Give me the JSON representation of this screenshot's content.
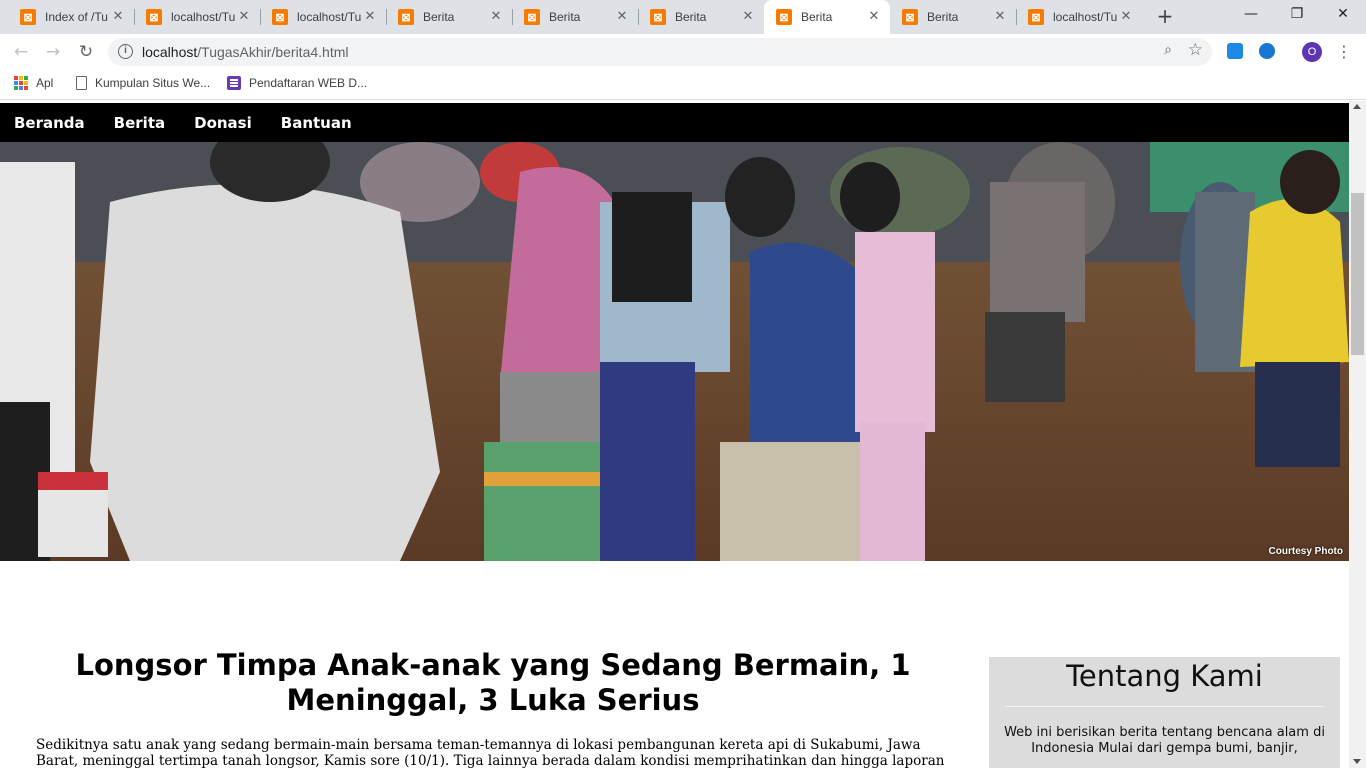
{
  "browser": {
    "tabs": [
      {
        "title": "Index of /Tu"
      },
      {
        "title": "localhost/Tu"
      },
      {
        "title": "localhost/Tu"
      },
      {
        "title": "Berita"
      },
      {
        "title": "Berita"
      },
      {
        "title": "Berita"
      },
      {
        "title": "Berita"
      },
      {
        "title": "Berita"
      },
      {
        "title": "localhost/Tu"
      }
    ],
    "active_tab_index": 6,
    "url_host": "localhost",
    "url_path": "/TugasAkhir/berita4.html",
    "profile_initial": "O",
    "bookmarks": [
      {
        "label": "Apl",
        "icon": "apps-grid-icon"
      },
      {
        "label": "Kumpulan Situs We...",
        "icon": "document-icon"
      },
      {
        "label": "Pendaftaran WEB D...",
        "icon": "form-icon"
      }
    ]
  },
  "site": {
    "nav": [
      "Beranda",
      "Berita",
      "Donasi",
      "Bantuan"
    ],
    "hero_credit": "Courtesy Photo",
    "article": {
      "title": "Longsor Timpa Anak-anak yang Sedang Bermain, 1 Meninggal, 3 Luka Serius",
      "body": "Sedikitnya satu anak yang sedang bermain-main bersama teman-temannya di lokasi pembangunan kereta api di Sukabumi, Jawa Barat, meninggal tertimpa tanah longsor, Kamis sore (10/1). Tiga lainnya berada dalam kondisi memprihatinkan dan hingga laporan ini disampaikan masih menjalani perawatan intensif"
    },
    "about": {
      "heading": "Tentang Kami",
      "text": "Web ini berisikan berita tentang bencana alam di Indonesia Mulai dari gempa bumi, banjir,"
    }
  },
  "colors": {
    "tab_favicon": "#f57c00",
    "site_nav_bg": "#000000",
    "about_bg": "#dcdcdc"
  }
}
